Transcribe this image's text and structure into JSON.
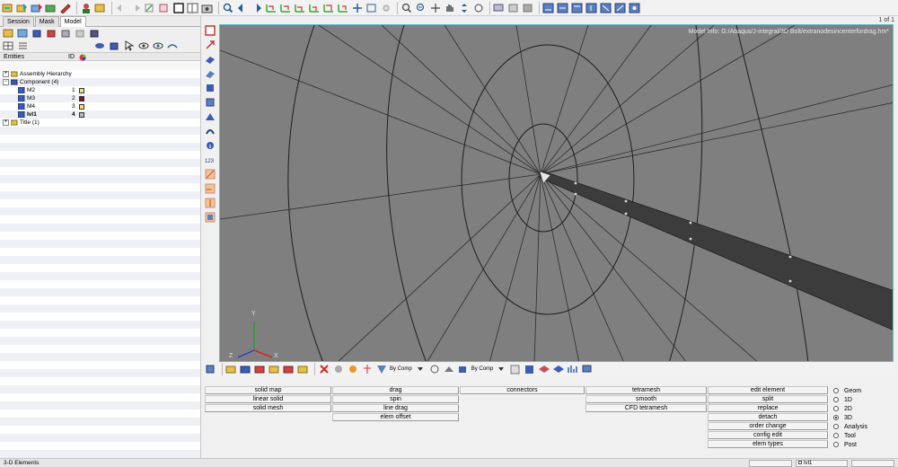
{
  "page_indicator": "1 of 1",
  "tabs": [
    "Session",
    "Mask",
    "Model"
  ],
  "entity_header": {
    "entities": "Entities",
    "id": "ID"
  },
  "entities": [
    {
      "label": "Assembly Hierarchy",
      "id": "",
      "color": ""
    },
    {
      "label": "Component (4)",
      "id": "",
      "color": ""
    },
    {
      "label": "M2",
      "id": "1",
      "color": "#ede37a"
    },
    {
      "label": "M3",
      "id": "2",
      "color": "#7c1430"
    },
    {
      "label": "M4",
      "id": "3",
      "color": "#f4e27a"
    },
    {
      "label": "Ivl1",
      "id": "4",
      "color": "#b8b8b8"
    },
    {
      "label": "Title (1)",
      "id": "",
      "color": ""
    }
  ],
  "model_info": "Model Info: G:/Abaqus/J-integral/3D Bolt/extranodesincenterfordrag.hm*",
  "axis_labels": {
    "x": "X",
    "y": "Y",
    "z": "Z"
  },
  "low_toolbar": {
    "dropdown1": "By Comp",
    "dropdown2": "By Comp"
  },
  "panel_buttons": {
    "col1": [
      "solid map",
      "linear solid",
      "solid mesh"
    ],
    "col2": [
      "drag",
      "spin",
      "line drag",
      "elem offset"
    ],
    "col3": [
      "connectors"
    ],
    "col4": [
      "tetramesh",
      "smooth",
      "CFD tetramesh"
    ],
    "col5": [
      "edit element",
      "split",
      "replace",
      "detach",
      "order change",
      "config edit",
      "elem types"
    ]
  },
  "radios": [
    "Geom",
    "1D",
    "2D",
    "3D",
    "Analysis",
    "Tool",
    "Post"
  ],
  "radio_selected": "3D",
  "status": {
    "left": "3-D Elements",
    "component": "Ivl1"
  },
  "colors": {
    "viewport_bg": "#7f7f7f",
    "viewport_border": "#5fb9c4"
  }
}
